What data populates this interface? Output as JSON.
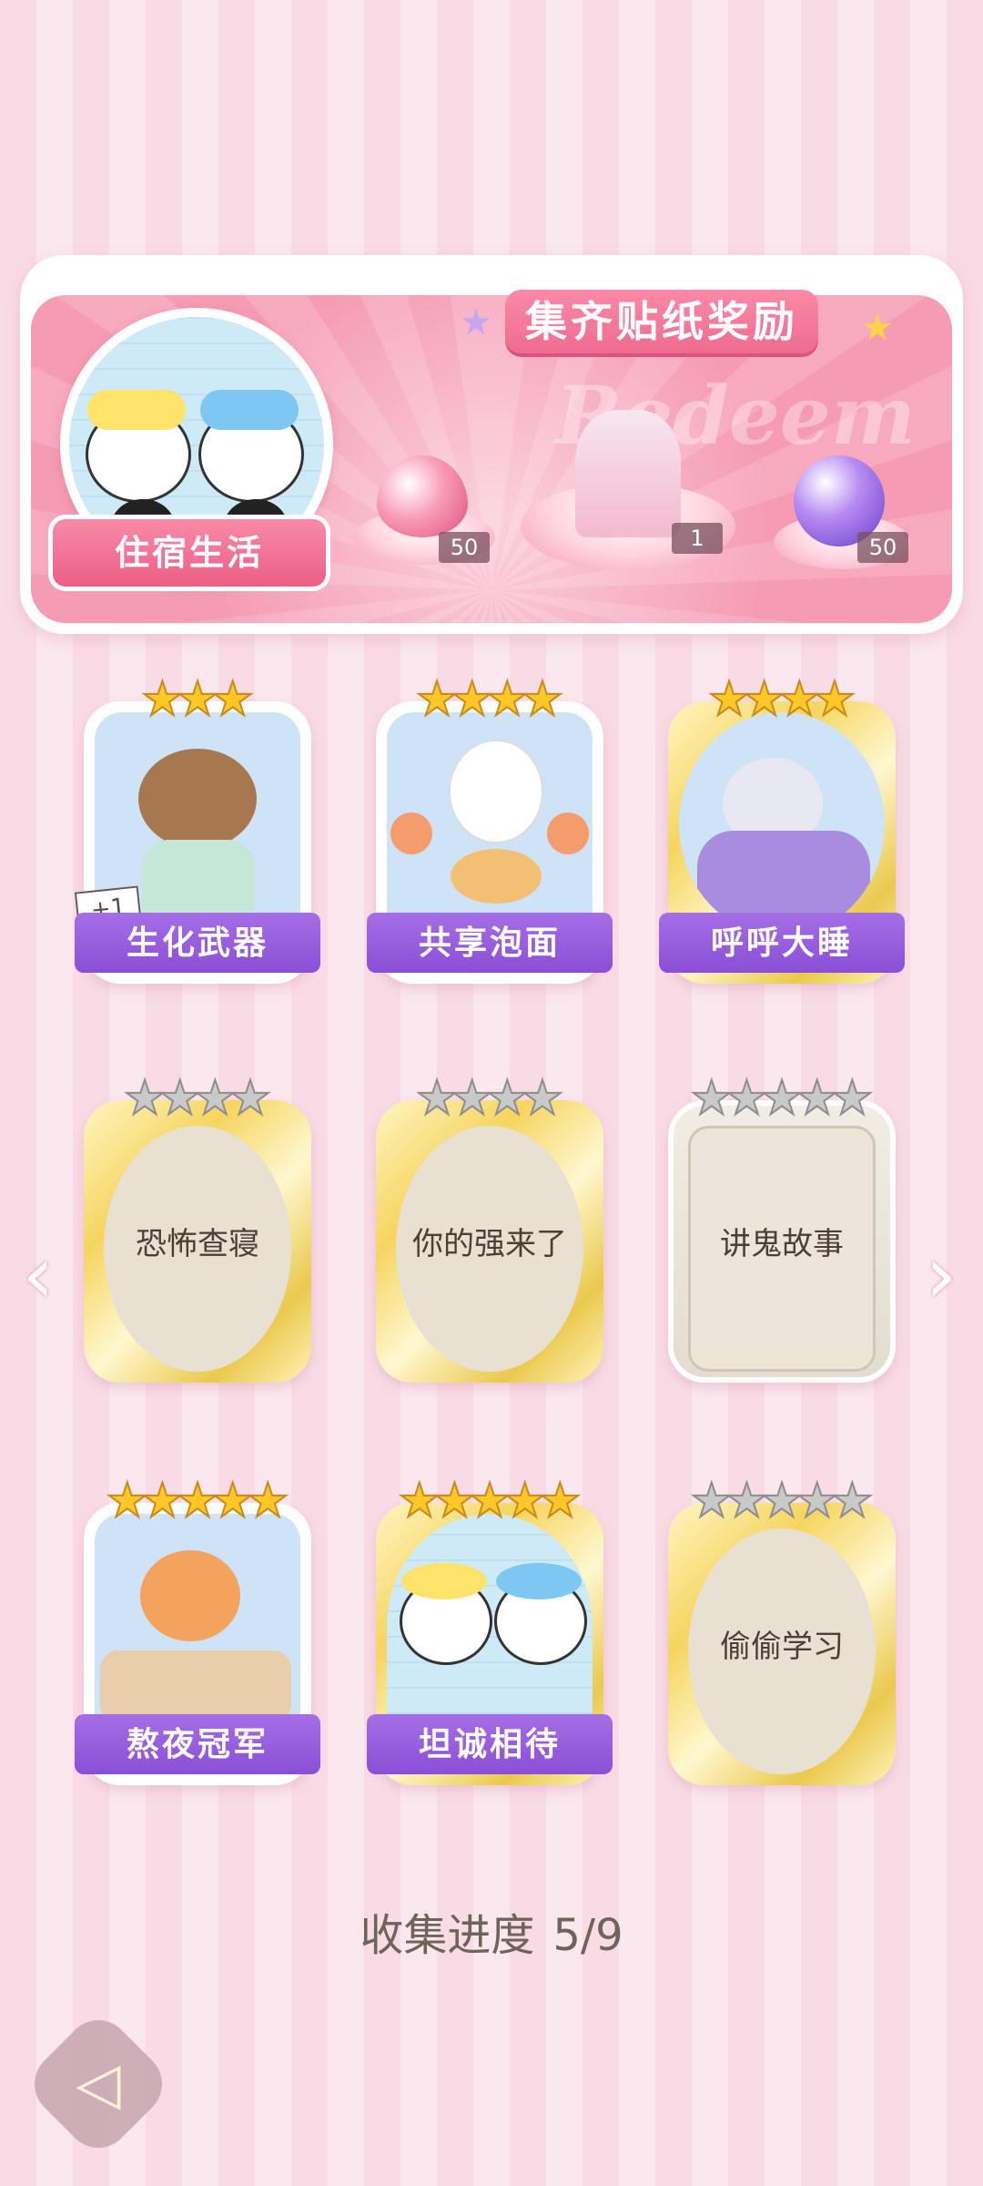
{
  "banner": {
    "title": "集齐贴纸奖励",
    "watermark": "Redeem",
    "theme_label": "住宿生活",
    "rewards": [
      {
        "icon": "pink-heart-gem-icon",
        "count": "50"
      },
      {
        "icon": "dress-outfit-icon",
        "count": "1"
      },
      {
        "icon": "purple-energy-orb-icon",
        "count": "50"
      }
    ]
  },
  "stickers": [
    {
      "name": "生化武器",
      "stars": 3,
      "state": "collected",
      "badge": "+1",
      "frame": "white"
    },
    {
      "name": "共享泡面",
      "stars": 4,
      "state": "collected",
      "frame": "white"
    },
    {
      "name": "呼呼大睡",
      "stars": 4,
      "state": "collected",
      "frame": "gold"
    },
    {
      "name": "恐怖查寝",
      "stars": 4,
      "state": "locked",
      "frame": "gold"
    },
    {
      "name": "你的强来了",
      "stars": 4,
      "state": "locked",
      "frame": "gold"
    },
    {
      "name": "讲鬼故事",
      "stars": 5,
      "state": "locked",
      "frame": "silver"
    },
    {
      "name": "熬夜冠军",
      "stars": 5,
      "state": "collected",
      "frame": "white"
    },
    {
      "name": "坦诚相待",
      "stars": 5,
      "state": "collected",
      "frame": "gold"
    },
    {
      "name": "偷偷学习",
      "stars": 5,
      "state": "locked",
      "frame": "gold"
    }
  ],
  "progress": {
    "label": "收集进度",
    "value": "5/9"
  },
  "nav": {
    "prev": "‹",
    "next": "›"
  },
  "colors": {
    "accent_pink": "#f08aa8",
    "name_band_purple": "#8a4fd6",
    "star_gold": "#ffc727"
  }
}
